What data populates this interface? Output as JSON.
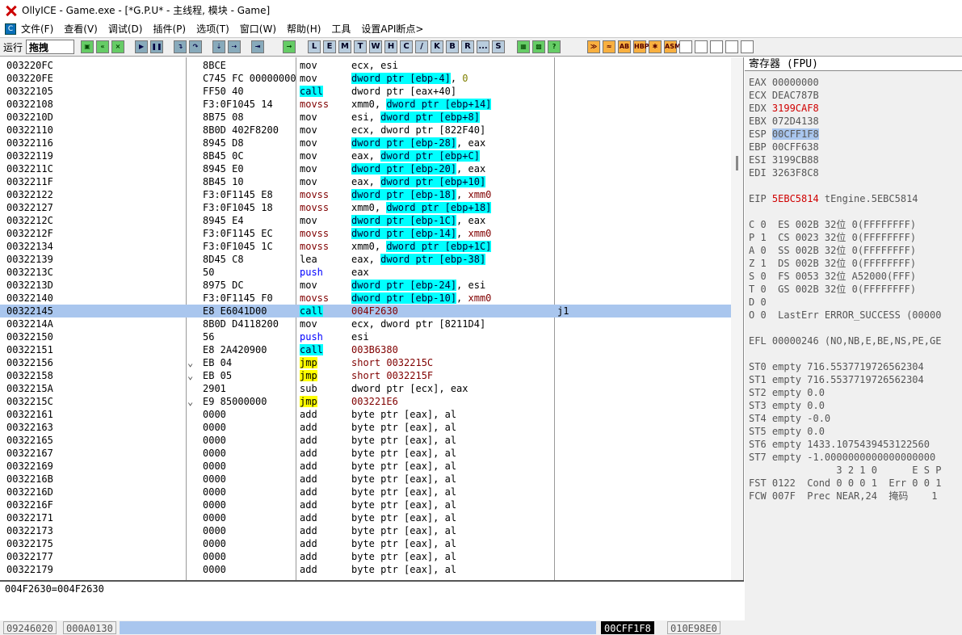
{
  "window": {
    "title": "OllyICE - Game.exe - [*G.P.U* -  主线程, 模块 - Game]"
  },
  "menu": [
    "文件(F)",
    "查看(V)",
    "调试(D)",
    "插件(P)",
    "选项(T)",
    "窗口(W)",
    "帮助(H)",
    "工具",
    "设置API断点>"
  ],
  "menu_icon_letter": "C",
  "toolbar": {
    "run_label": "运行",
    "status": "拖拽",
    "buttons_a": [
      "open",
      "restart",
      "close"
    ],
    "buttons_b": [
      "run",
      "pause"
    ],
    "buttons_c": [
      "step-into",
      "step-over",
      "trace-into",
      "trace-over",
      "execute-till-return"
    ],
    "goto": "goto",
    "letters": [
      "L",
      "E",
      "M",
      "T",
      "W",
      "H",
      "C",
      "/",
      "K",
      "B",
      "R",
      "...",
      "S"
    ],
    "buttons_d": [
      "grid1",
      "grid2",
      "help"
    ],
    "buttons_e": [
      "anim1",
      "anim2",
      "AB",
      "HBP",
      "gear",
      "ASM"
    ]
  },
  "disasm": [
    {
      "addr": "003220FC",
      "mark": "",
      "hex": "8BCE",
      "mn": "mov",
      "mt": "n",
      "ops": [
        [
          "ecx, esi",
          ""
        ]
      ]
    },
    {
      "addr": "003220FE",
      "mark": "",
      "hex": "C745 FC 00000000",
      "mn": "mov",
      "mt": "n",
      "ops": [
        [
          "dword ptr [ebp-4]",
          "hl"
        ],
        [
          ", ",
          ""
        ],
        [
          "0",
          "num"
        ]
      ]
    },
    {
      "addr": "00322105",
      "mark": "",
      "hex": "FF50 40",
      "mn": "call",
      "mt": "call",
      "ops": [
        [
          "dword ptr [eax+40]",
          ""
        ]
      ]
    },
    {
      "addr": "00322108",
      "mark": "",
      "hex": "F3:0F1045 14",
      "mn": "movss",
      "mt": "movss",
      "ops": [
        [
          "xmm0, ",
          ""
        ],
        [
          "dword ptr [ebp+14]",
          "hl"
        ]
      ]
    },
    {
      "addr": "0032210D",
      "mark": "",
      "hex": "8B75 08",
      "mn": "mov",
      "mt": "n",
      "ops": [
        [
          "esi, ",
          ""
        ],
        [
          "dword ptr [ebp+8]",
          "hl"
        ]
      ]
    },
    {
      "addr": "00322110",
      "mark": "",
      "hex": "8B0D 402F8200",
      "mn": "mov",
      "mt": "n",
      "ops": [
        [
          "ecx, dword ptr [822F40]",
          ""
        ]
      ]
    },
    {
      "addr": "00322116",
      "mark": "",
      "hex": "8945 D8",
      "mn": "mov",
      "mt": "n",
      "ops": [
        [
          "dword ptr [ebp-28]",
          "hl"
        ],
        [
          ", eax",
          ""
        ]
      ]
    },
    {
      "addr": "00322119",
      "mark": "",
      "hex": "8B45 0C",
      "mn": "mov",
      "mt": "n",
      "ops": [
        [
          "eax, ",
          ""
        ],
        [
          "dword ptr [ebp+C]",
          "hl"
        ]
      ]
    },
    {
      "addr": "0032211C",
      "mark": "",
      "hex": "8945 E0",
      "mn": "mov",
      "mt": "n",
      "ops": [
        [
          "dword ptr [ebp-20]",
          "hl"
        ],
        [
          ", eax",
          ""
        ]
      ]
    },
    {
      "addr": "0032211F",
      "mark": "",
      "hex": "8B45 10",
      "mn": "mov",
      "mt": "n",
      "ops": [
        [
          "eax, ",
          ""
        ],
        [
          "dword ptr [ebp+10]",
          "hl"
        ]
      ]
    },
    {
      "addr": "00322122",
      "mark": "",
      "hex": "F3:0F1145 E8",
      "mn": "movss",
      "mt": "movss",
      "ops": [
        [
          "dword ptr [ebp-18]",
          "hl"
        ],
        [
          ", ",
          ""
        ],
        [
          "xmm0",
          "addr-red"
        ]
      ]
    },
    {
      "addr": "00322127",
      "mark": "",
      "hex": "F3:0F1045 18",
      "mn": "movss",
      "mt": "movss",
      "ops": [
        [
          "xmm0, ",
          ""
        ],
        [
          "dword ptr [ebp+18]",
          "hl"
        ]
      ]
    },
    {
      "addr": "0032212C",
      "mark": "",
      "hex": "8945 E4",
      "mn": "mov",
      "mt": "n",
      "ops": [
        [
          "dword ptr [ebp-1C]",
          "hl"
        ],
        [
          ", eax",
          ""
        ]
      ]
    },
    {
      "addr": "0032212F",
      "mark": "",
      "hex": "F3:0F1145 EC",
      "mn": "movss",
      "mt": "movss",
      "ops": [
        [
          "dword ptr [ebp-14]",
          "hl"
        ],
        [
          ", ",
          ""
        ],
        [
          "xmm0",
          "addr-red"
        ]
      ]
    },
    {
      "addr": "00322134",
      "mark": "",
      "hex": "F3:0F1045 1C",
      "mn": "movss",
      "mt": "movss",
      "ops": [
        [
          "xmm0, ",
          ""
        ],
        [
          "dword ptr [ebp+1C]",
          "hl"
        ]
      ]
    },
    {
      "addr": "00322139",
      "mark": "",
      "hex": "8D45 C8",
      "mn": "lea",
      "mt": "n",
      "ops": [
        [
          "eax, ",
          ""
        ],
        [
          "dword ptr [ebp-38]",
          "hl"
        ]
      ]
    },
    {
      "addr": "0032213C",
      "mark": "",
      "hex": "50",
      "mn": "push",
      "mt": "push",
      "ops": [
        [
          "eax",
          ""
        ]
      ]
    },
    {
      "addr": "0032213D",
      "mark": "",
      "hex": "8975 DC",
      "mn": "mov",
      "mt": "n",
      "ops": [
        [
          "dword ptr [ebp-24]",
          "hl"
        ],
        [
          ", esi",
          ""
        ]
      ]
    },
    {
      "addr": "00322140",
      "mark": "",
      "hex": "F3:0F1145 F0",
      "mn": "movss",
      "mt": "movss",
      "ops": [
        [
          "dword ptr [ebp-10]",
          "hl"
        ],
        [
          ", ",
          ""
        ],
        [
          "xmm0",
          "addr-red"
        ]
      ]
    },
    {
      "addr": "00322145",
      "mark": "",
      "hex": "E8 E6041D00",
      "mn": "call",
      "mt": "call",
      "ops": [
        [
          "004F2630",
          "addr-red"
        ]
      ],
      "comment": "j1",
      "selected": true
    },
    {
      "addr": "0032214A",
      "mark": "",
      "hex": "8B0D D4118200",
      "mn": "mov",
      "mt": "n",
      "ops": [
        [
          "ecx, dword ptr [8211D4]",
          ""
        ]
      ]
    },
    {
      "addr": "00322150",
      "mark": "",
      "hex": "56",
      "mn": "push",
      "mt": "push",
      "ops": [
        [
          "esi",
          ""
        ]
      ]
    },
    {
      "addr": "00322151",
      "mark": "",
      "hex": "E8 2A420900",
      "mn": "call",
      "mt": "call",
      "ops": [
        [
          "003B6380",
          "addr-red"
        ]
      ]
    },
    {
      "addr": "00322156",
      "mark": "⌄",
      "hex": "EB 04",
      "mn": "jmp",
      "mt": "jmp",
      "ops": [
        [
          "short 0032215C",
          "addr-red"
        ]
      ]
    },
    {
      "addr": "00322158",
      "mark": "⌄",
      "hex": "EB 05",
      "mn": "jmp",
      "mt": "jmp",
      "ops": [
        [
          "short 0032215F",
          "addr-red"
        ]
      ]
    },
    {
      "addr": "0032215A",
      "mark": "",
      "hex": "2901",
      "mn": "sub",
      "mt": "n",
      "ops": [
        [
          "dword ptr [ecx], eax",
          ""
        ]
      ]
    },
    {
      "addr": "0032215C",
      "mark": "⌄",
      "hex": "E9 85000000",
      "mn": "jmp",
      "mt": "jmp",
      "ops": [
        [
          "003221E6",
          "addr-red"
        ]
      ]
    },
    {
      "addr": "00322161",
      "mark": "",
      "hex": "0000",
      "mn": "add",
      "mt": "n",
      "ops": [
        [
          "byte ptr [eax], al",
          ""
        ]
      ]
    },
    {
      "addr": "00322163",
      "mark": "",
      "hex": "0000",
      "mn": "add",
      "mt": "n",
      "ops": [
        [
          "byte ptr [eax], al",
          ""
        ]
      ]
    },
    {
      "addr": "00322165",
      "mark": "",
      "hex": "0000",
      "mn": "add",
      "mt": "n",
      "ops": [
        [
          "byte ptr [eax], al",
          ""
        ]
      ]
    },
    {
      "addr": "00322167",
      "mark": "",
      "hex": "0000",
      "mn": "add",
      "mt": "n",
      "ops": [
        [
          "byte ptr [eax], al",
          ""
        ]
      ]
    },
    {
      "addr": "00322169",
      "mark": "",
      "hex": "0000",
      "mn": "add",
      "mt": "n",
      "ops": [
        [
          "byte ptr [eax], al",
          ""
        ]
      ]
    },
    {
      "addr": "0032216B",
      "mark": "",
      "hex": "0000",
      "mn": "add",
      "mt": "n",
      "ops": [
        [
          "byte ptr [eax], al",
          ""
        ]
      ]
    },
    {
      "addr": "0032216D",
      "mark": "",
      "hex": "0000",
      "mn": "add",
      "mt": "n",
      "ops": [
        [
          "byte ptr [eax], al",
          ""
        ]
      ]
    },
    {
      "addr": "0032216F",
      "mark": "",
      "hex": "0000",
      "mn": "add",
      "mt": "n",
      "ops": [
        [
          "byte ptr [eax], al",
          ""
        ]
      ]
    },
    {
      "addr": "00322171",
      "mark": "",
      "hex": "0000",
      "mn": "add",
      "mt": "n",
      "ops": [
        [
          "byte ptr [eax], al",
          ""
        ]
      ]
    },
    {
      "addr": "00322173",
      "mark": "",
      "hex": "0000",
      "mn": "add",
      "mt": "n",
      "ops": [
        [
          "byte ptr [eax], al",
          ""
        ]
      ]
    },
    {
      "addr": "00322175",
      "mark": "",
      "hex": "0000",
      "mn": "add",
      "mt": "n",
      "ops": [
        [
          "byte ptr [eax], al",
          ""
        ]
      ]
    },
    {
      "addr": "00322177",
      "mark": "",
      "hex": "0000",
      "mn": "add",
      "mt": "n",
      "ops": [
        [
          "byte ptr [eax], al",
          ""
        ]
      ]
    },
    {
      "addr": "00322179",
      "mark": "",
      "hex": "0000",
      "mn": "add",
      "mt": "n",
      "ops": [
        [
          "byte ptr [eax], al",
          ""
        ]
      ]
    }
  ],
  "info_line": "004F2630=004F2630",
  "registers": {
    "header": "寄存器 (FPU)",
    "lines": [
      [
        [
          "EAX 00000000",
          ""
        ]
      ],
      [
        [
          "ECX DEAC787B",
          ""
        ]
      ],
      [
        [
          "EDX ",
          ""
        ],
        [
          "3199CAF8",
          "red"
        ]
      ],
      [
        [
          "EBX 072D4138",
          ""
        ]
      ],
      [
        [
          "ESP ",
          ""
        ],
        [
          "00CFF1F8",
          "selbox"
        ]
      ],
      [
        [
          "EBP 00CFF638",
          ""
        ]
      ],
      [
        [
          "ESI 3199CB88",
          ""
        ]
      ],
      [
        [
          "EDI 3263F8C8",
          ""
        ]
      ],
      [
        [
          "",
          ""
        ]
      ],
      [
        [
          "EIP ",
          ""
        ],
        [
          "5EBC5814",
          "red"
        ],
        [
          " tEngine.5EBC5814",
          ""
        ]
      ],
      [
        [
          "",
          ""
        ]
      ],
      [
        [
          "C 0  ES 002B 32位 0(FFFFFFFF)",
          ""
        ]
      ],
      [
        [
          "P 1  CS 0023 32位 0(FFFFFFFF)",
          ""
        ]
      ],
      [
        [
          "A 0  SS 002B 32位 0(FFFFFFFF)",
          ""
        ]
      ],
      [
        [
          "Z 1  DS 002B 32位 0(FFFFFFFF)",
          ""
        ]
      ],
      [
        [
          "S 0  FS 0053 32位 A52000(FFF)",
          ""
        ]
      ],
      [
        [
          "T 0  GS 002B 32位 0(FFFFFFFF)",
          ""
        ]
      ],
      [
        [
          "D 0",
          ""
        ]
      ],
      [
        [
          "O 0  LastErr ERROR_SUCCESS (00000",
          ""
        ]
      ],
      [
        [
          "",
          ""
        ]
      ],
      [
        [
          "EFL 00000246 (NO,NB,E,BE,NS,PE,GE",
          ""
        ]
      ],
      [
        [
          "",
          ""
        ]
      ],
      [
        [
          "ST0 empty 716.5537719726562304",
          ""
        ]
      ],
      [
        [
          "ST1 empty 716.5537719726562304",
          ""
        ]
      ],
      [
        [
          "ST2 empty 0.0",
          ""
        ]
      ],
      [
        [
          "ST3 empty 0.0",
          ""
        ]
      ],
      [
        [
          "ST4 empty -0.0",
          ""
        ]
      ],
      [
        [
          "ST5 empty 0.0",
          ""
        ]
      ],
      [
        [
          "ST6 empty 1433.1075439453122560",
          ""
        ]
      ],
      [
        [
          "ST7 empty -1.0000000000000000000",
          ""
        ]
      ],
      [
        [
          "               3 2 1 0      E S P",
          ""
        ]
      ],
      [
        [
          "FST 0122  Cond 0 0 0 1  Err 0 0 1",
          ""
        ]
      ],
      [
        [
          "FCW 007F  Prec NEAR,24  掩码    1",
          ""
        ]
      ]
    ]
  },
  "statusbar": {
    "a": "09246020",
    "b": "000A0130",
    "c": "00CFF1F8",
    "d": "010E98E0"
  }
}
